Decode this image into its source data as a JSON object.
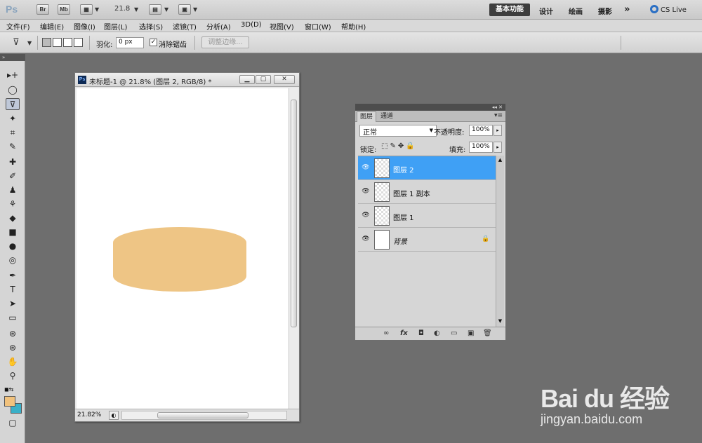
{
  "appbar": {
    "logo": "Ps",
    "bridge_btn": "Br",
    "minibridge_btn": "Mb",
    "zoom_value": "21.8",
    "workspaces": [
      "基本功能",
      "设计",
      "绘画",
      "摄影"
    ],
    "more": "»",
    "cs_live": "CS Live"
  },
  "menu": [
    "文件(F)",
    "编辑(E)",
    "图像(I)",
    "图层(L)",
    "选择(S)",
    "滤镜(T)",
    "分析(A)",
    "3D(D)",
    "视图(V)",
    "窗口(W)",
    "帮助(H)"
  ],
  "options": {
    "feather_label": "羽化:",
    "feather_value": "0 px",
    "antialias_checked": "✓",
    "antialias_label": "消除锯齿",
    "refine_edge": "调整边缘..."
  },
  "tools": {
    "header": "»",
    "items": [
      "▸+",
      "◯",
      "⊽",
      "✦",
      "⌗",
      "✎",
      "✚",
      "✐",
      "♟",
      "⚘",
      "◆",
      "■",
      "●",
      "◎",
      "✒",
      "T",
      "➤",
      "▭",
      "⊛",
      "⊛",
      "✋",
      "⚲",
      "◑",
      "▢"
    ]
  },
  "document": {
    "title": "未标题-1 @ 21.8% (图层 2, RGB/8) *",
    "zoom": "21.82%",
    "shape_color": "#EEC585"
  },
  "layers_panel": {
    "collapse": "◂◂ ✕",
    "tabs": [
      "图层",
      "通道"
    ],
    "tab_menu": "▾≡",
    "blend_mode": "正常",
    "opacity_label": "不透明度:",
    "opacity_value": "100%",
    "lock_label": "锁定:",
    "fill_label": "填充:",
    "fill_value": "100%",
    "layers": [
      {
        "name": "图层 2"
      },
      {
        "name": "图层 1 副本"
      },
      {
        "name": "图层 1"
      },
      {
        "name": "背景"
      }
    ],
    "footer_icons": [
      "∞",
      "fx",
      "◘",
      "◐",
      "▭",
      "▣",
      "🗑"
    ]
  },
  "watermark": {
    "logo": "Bai du 经验",
    "url": "jingyan.baidu.com"
  },
  "colors": {
    "selected_layer": "#3FA0F5",
    "foreground": "#F1C27D",
    "background": "#3AB0C8"
  }
}
